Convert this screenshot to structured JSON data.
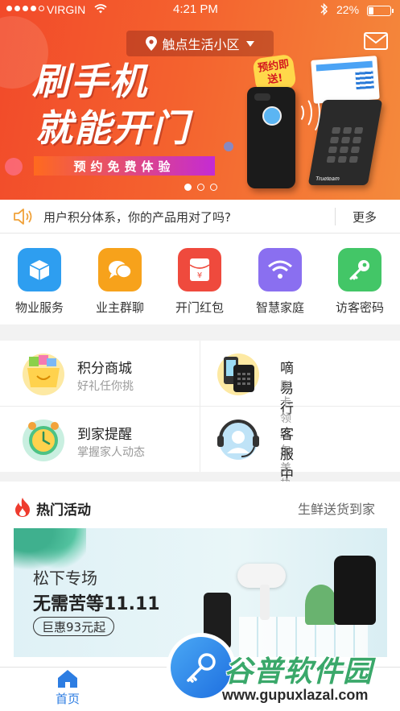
{
  "status_bar": {
    "carrier": "VIRGIN",
    "time": "4:21 PM",
    "battery": "22%"
  },
  "header": {
    "location": "触点生活小区"
  },
  "banner": {
    "slogan_line1": "刷手机",
    "slogan_line2": "就能开门",
    "cta": "预约免费体验",
    "reserve_bubble": "预约即送!",
    "reader_brand": "Trueteam",
    "page_count": 3,
    "active_page": 1
  },
  "notice": {
    "text": "用户积分体系，你的产品用对了吗?",
    "more": "更多"
  },
  "services": [
    {
      "label": "物业服务",
      "color": "#2e9ef0"
    },
    {
      "label": "业主群聊",
      "color": "#f7a21b"
    },
    {
      "label": "开门红包",
      "color": "#ef4a3d"
    },
    {
      "label": "智慧家庭",
      "color": "#8a6ff0"
    },
    {
      "label": "访客密码",
      "color": "#43c667"
    }
  ],
  "features": [
    {
      "title": "积分商城",
      "subtitle": "好礼任你挑"
    },
    {
      "title": "嘀易行",
      "subtitle": "刷卡领红包"
    },
    {
      "title": "到家提醒",
      "subtitle": "掌握家人动态"
    },
    {
      "title": "客服中心",
      "subtitle": "小美热情解惑"
    }
  ],
  "hot": {
    "title": "热门活动",
    "link": "生鲜送货到家",
    "promo": {
      "line1": "松下专场",
      "line2": "无需苦等11.11",
      "badge": "巨惠93元起"
    }
  },
  "tabbar": {
    "home": "首页"
  },
  "watermark": {
    "line1": "谷普软件园",
    "line2": "www.gupuxlazal.com"
  },
  "colors": {
    "accent": "#2d7de2",
    "banner": "#f24a2a"
  }
}
